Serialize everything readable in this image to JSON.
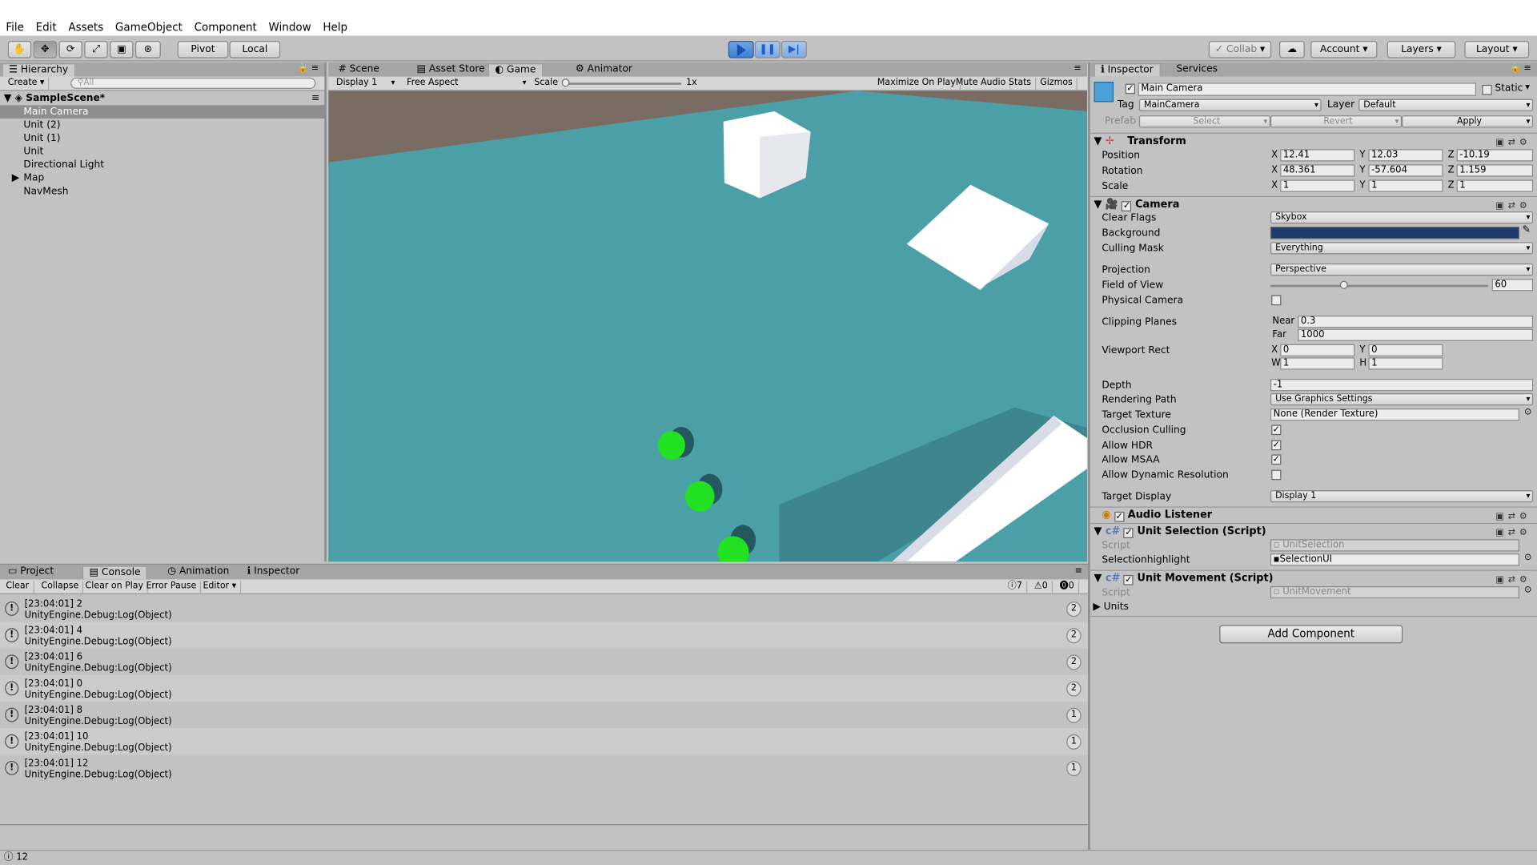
{
  "menubar": {
    "items": [
      "File",
      "Edit",
      "Assets",
      "GameObject",
      "Component",
      "Window",
      "Help"
    ]
  },
  "toolbar": {
    "tools": [
      {
        "name": "hand-tool-button",
        "icon": "hand-icon"
      },
      {
        "name": "move-tool-button",
        "icon": "move-icon"
      },
      {
        "name": "rotate-tool-button",
        "icon": "rotate-icon"
      },
      {
        "name": "scale-tool-button",
        "icon": "scale-icon"
      },
      {
        "name": "rect-tool-button",
        "icon": "rect-icon"
      },
      {
        "name": "transform-tool-button",
        "icon": "transform-icon"
      }
    ],
    "pivot": "Pivot",
    "local": "Local",
    "collab": "Collab",
    "account": "Account",
    "layers": "Layers",
    "layout": "Layout"
  },
  "hierarchy": {
    "tab": "Hierarchy",
    "create": "Create",
    "search_placeholder": "All",
    "scene": "SampleScene*",
    "items": [
      "Main Camera",
      "Unit (2)",
      "Unit (1)",
      "Unit",
      "Directional Light",
      "Map",
      "NavMesh"
    ]
  },
  "center": {
    "tabs": [
      "Scene",
      "Asset Store",
      "Game",
      "Animator"
    ],
    "display": "Display 1",
    "aspect": "Free Aspect",
    "scale_label": "Scale",
    "scale_value": "1x",
    "buttons": [
      "Maximize On Play",
      "Mute Audio",
      "Stats",
      "Gizmos"
    ]
  },
  "bottom": {
    "tabs": [
      "Project",
      "Console",
      "Animation",
      "Inspector"
    ],
    "buttons": [
      "Clear",
      "Collapse",
      "Clear on Play",
      "Error Pause",
      "Editor"
    ],
    "counts": {
      "info": "7",
      "warn": "0",
      "error": "0"
    },
    "logs": [
      {
        "line1": "[23:04:01] 2",
        "line2": "UnityEngine.Debug:Log(Object)",
        "count": "2"
      },
      {
        "line1": "[23:04:01] 4",
        "line2": "UnityEngine.Debug:Log(Object)",
        "count": "2"
      },
      {
        "line1": "[23:04:01] 6",
        "line2": "UnityEngine.Debug:Log(Object)",
        "count": "2"
      },
      {
        "line1": "[23:04:01] 0",
        "line2": "UnityEngine.Debug:Log(Object)",
        "count": "2"
      },
      {
        "line1": "[23:04:01] 8",
        "line2": "UnityEngine.Debug:Log(Object)",
        "count": "1"
      },
      {
        "line1": "[23:04:01] 10",
        "line2": "UnityEngine.Debug:Log(Object)",
        "count": "1"
      },
      {
        "line1": "[23:04:01] 12",
        "line2": "UnityEngine.Debug:Log(Object)",
        "count": "1"
      }
    ],
    "status": "12"
  },
  "inspector": {
    "tabs": [
      "Inspector",
      "Services"
    ],
    "object_name": "Main Camera",
    "static_label": "Static",
    "tag_label": "Tag",
    "tag": "MainCamera",
    "layer_label": "Layer",
    "layer": "Default",
    "prefab_label": "Prefab",
    "prefab_buttons": [
      "Select",
      "Revert",
      "Apply"
    ],
    "transform": {
      "title": "Transform",
      "rows": [
        {
          "label": "Position",
          "x": "12.41",
          "y": "12.03",
          "z": "-10.19"
        },
        {
          "label": "Rotation",
          "x": "48.361",
          "y": "-57.604",
          "z": "1.159"
        },
        {
          "label": "Scale",
          "x": "1",
          "y": "1",
          "z": "1"
        }
      ]
    },
    "camera": {
      "title": "Camera",
      "clear_flags_label": "Clear Flags",
      "clear_flags": "Skybox",
      "background_label": "Background",
      "background_color": "#1f3b6b",
      "culling_label": "Culling Mask",
      "culling": "Everything",
      "projection_label": "Projection",
      "projection": "Perspective",
      "fov_label": "Field of View",
      "fov": "60",
      "physical_label": "Physical Camera",
      "clipping_label": "Clipping Planes",
      "near_label": "Near",
      "near": "0.3",
      "far_label": "Far",
      "far": "1000",
      "viewport_label": "Viewport Rect",
      "vx": "0",
      "vy": "0",
      "vw": "1",
      "vh": "1",
      "depth_label": "Depth",
      "depth": "-1",
      "rendering_label": "Rendering Path",
      "rendering": "Use Graphics Settings",
      "target_tex_label": "Target Texture",
      "target_tex": "None (Render Texture)",
      "occlusion_label": "Occlusion Culling",
      "hdr_label": "Allow HDR",
      "msaa_label": "Allow MSAA",
      "dynres_label": "Allow Dynamic Resolution",
      "target_display_label": "Target Display",
      "target_display": "Display 1"
    },
    "audio_listener": "Audio Listener",
    "unit_selection": {
      "title": "Unit Selection (Script)",
      "script_label": "Script",
      "script": "UnitSelection",
      "highlight_label": "Selectionhighlight",
      "highlight": "SelectionUI"
    },
    "unit_movement": {
      "title": "Unit Movement (Script)",
      "script_label": "Script",
      "script": "UnitMovement",
      "units_label": "Units"
    },
    "add_component": "Add Component"
  }
}
